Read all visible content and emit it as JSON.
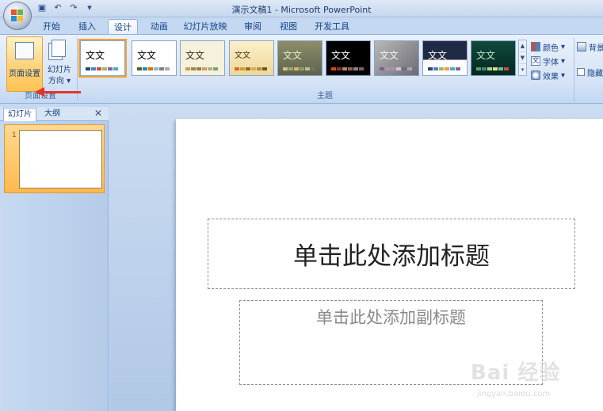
{
  "window": {
    "title": "演示文稿1 - Microsoft PowerPoint"
  },
  "qat": [
    "save-icon",
    "undo-icon",
    "redo-icon",
    "customize-icon"
  ],
  "tabs": [
    {
      "label": "开始"
    },
    {
      "label": "插入"
    },
    {
      "label": "设计",
      "active": true
    },
    {
      "label": "动画"
    },
    {
      "label": "幻灯片放映"
    },
    {
      "label": "审阅"
    },
    {
      "label": "视图"
    },
    {
      "label": "开发工具"
    }
  ],
  "ribbon": {
    "page_setup": {
      "page_setup_label": "页面设置",
      "orientation_label_1": "幻灯片",
      "orientation_label_2": "方向",
      "group_label": "页面设置"
    },
    "themes": {
      "group_label": "主题",
      "items": [
        {
          "text": "文文"
        },
        {
          "text": "文文"
        },
        {
          "text": "文文"
        },
        {
          "text": "文文"
        },
        {
          "text": "文文"
        },
        {
          "text": "文文"
        },
        {
          "text": "文文"
        },
        {
          "text": "文文"
        },
        {
          "text": "文文"
        }
      ],
      "colors_label": "颜色",
      "fonts_label": "字体",
      "effects_label": "效果"
    },
    "background": {
      "bg_styles_label": "背景",
      "hide_bg_label": "隐藏"
    }
  },
  "pane": {
    "tab_slides": "幻灯片",
    "tab_outline": "大纲",
    "slide_number": "1"
  },
  "slide": {
    "title_placeholder": "单击此处添加标题",
    "subtitle_placeholder": "单击此处添加副标题"
  },
  "watermark": {
    "logo": "Bai 经验",
    "sub": "jingyan.baidu.com"
  },
  "colors": {
    "accent_orange": "#ffc353",
    "annotation_red": "#e2342b",
    "ribbon_blue": "#d5e3f6"
  }
}
